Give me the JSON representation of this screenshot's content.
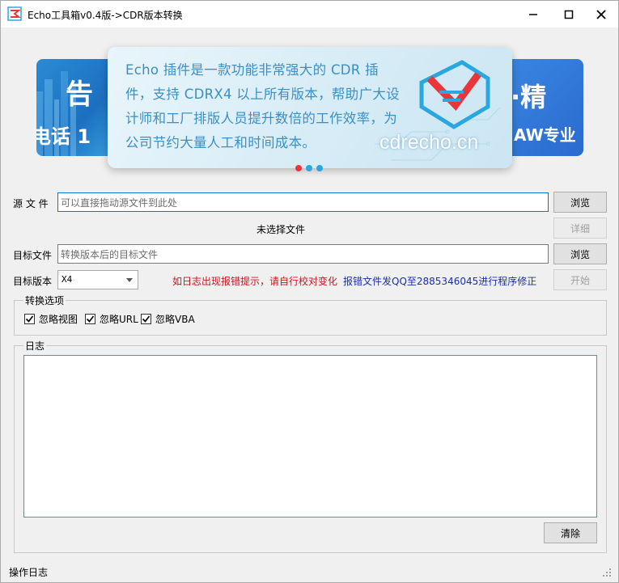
{
  "window": {
    "title": "Echo工具箱v0.4版->CDR版本转换",
    "minimize_glyph": "–",
    "maximize_glyph": "□",
    "close_glyph": "✕",
    "icon": "echo-logo-icon"
  },
  "banner": {
    "left_card_text_top": "告",
    "left_card_text_bottom": "电话 1",
    "right_card_text_top": "·精",
    "right_card_text_bottom": "AW专业",
    "main_text": "Echo 插件是一款功能非常强大的 CDR 插件，支持 CDRX4 以上所有版本，帮助广大设计师和工厂排版人员提升数倍的工作效率，为公司节约大量人工和时间成本。",
    "site": "cdrecho.cn",
    "dot_colors": [
      "#e8363b",
      "#2aa7e0",
      "#2aa7e0"
    ]
  },
  "source": {
    "label": "源 文 件",
    "placeholder": "可以直接拖动源文件到此处",
    "browse": "浏览",
    "status": "未选择文件",
    "detail": "详细"
  },
  "target": {
    "label": "目标文件",
    "placeholder": "转换版本后的目标文件",
    "browse": "浏览"
  },
  "version": {
    "label": "目标版本",
    "value": "X4",
    "notice_red": "如日志出现报错提示，请自行校对变化",
    "notice_blue": "报错文件发QQ至2885346045进行程序修正",
    "start": "开始"
  },
  "options": {
    "title": "转换选项",
    "items": [
      {
        "label": "忽略视图",
        "checked": true
      },
      {
        "label": "忽略URL",
        "checked": true
      },
      {
        "label": "忽略VBA",
        "checked": true
      }
    ]
  },
  "log": {
    "title": "日志",
    "content": "",
    "clear": "清除"
  },
  "statusbar": {
    "text": "操作日志"
  },
  "colors": {
    "accent": "#0078d7",
    "notice_red": "#c8161d",
    "notice_blue": "#1a2fa8",
    "brand_blue": "#3b8fc5",
    "brand_red": "#e8363b"
  }
}
